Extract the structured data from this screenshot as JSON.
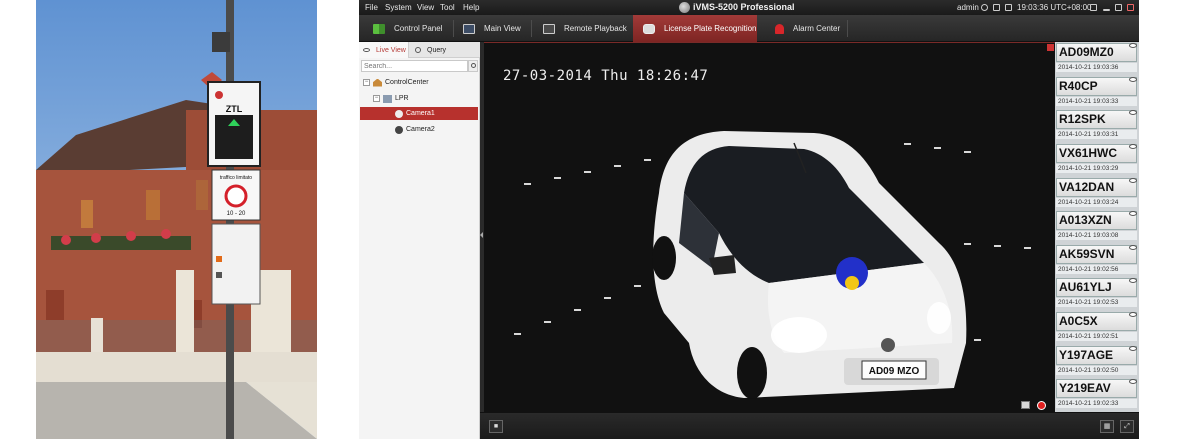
{
  "menu": {
    "items": [
      "File",
      "System",
      "View",
      "Tool",
      "Help"
    ],
    "app_title": "iVMS-5200 Professional",
    "user": "admin",
    "clock": "19:03:36 UTC+08:00"
  },
  "toolbar": {
    "tabs": [
      {
        "label": "Control Panel",
        "icon": "grid-icon"
      },
      {
        "label": "Main View",
        "icon": "monitor-icon"
      },
      {
        "label": "Remote Playback",
        "icon": "playback-icon"
      },
      {
        "label": "License Plate Recognition",
        "icon": "car-icon",
        "active": true
      },
      {
        "label": "Alarm Center",
        "icon": "alarm-icon"
      }
    ]
  },
  "left_panel": {
    "tabs": [
      {
        "label": "Live View",
        "active": true
      },
      {
        "label": "Query"
      }
    ],
    "search_placeholder": "Search...",
    "tree": [
      {
        "label": "ControlCenter",
        "level": 0
      },
      {
        "label": "LPR",
        "level": 1
      },
      {
        "label": "Camera1",
        "level": 2,
        "selected": true
      },
      {
        "label": "Camera2",
        "level": 2
      }
    ]
  },
  "video": {
    "timestamp": "27-03-2014 Thu 18:26:47",
    "plate_on_car": "AD09 MZO"
  },
  "photo": {
    "sign_ztl": "ZTL",
    "sign_limit_title": "traffico limitato",
    "sign_limit_hours": "10 - 20"
  },
  "plates": [
    {
      "number": "AD09MZ0",
      "time": "2014-10-21 19:03:36"
    },
    {
      "number": "R40CP",
      "time": "2014-10-21 19:03:33"
    },
    {
      "number": "R12SPK",
      "time": "2014-10-21 19:03:31"
    },
    {
      "number": "VX61HWC",
      "time": "2014-10-21 19:03:29"
    },
    {
      "number": "VA12DAN",
      "time": "2014-10-21 19:03:24"
    },
    {
      "number": "A013XZN",
      "time": "2014-10-21 19:03:08"
    },
    {
      "number": "AK59SVN",
      "time": "2014-10-21 19:02:56"
    },
    {
      "number": "AU61YLJ",
      "time": "2014-10-21 19:02:53"
    },
    {
      "number": "A0C5X",
      "time": "2014-10-21 19:02:51"
    },
    {
      "number": "Y197AGE",
      "time": "2014-10-21 19:02:50"
    },
    {
      "number": "Y219EAV",
      "time": "2014-10-21 19:02:33"
    }
  ],
  "colors": {
    "accent": "#b7312d",
    "window_dark": "#202020",
    "plate_list_bg": "#cfd3d6"
  }
}
